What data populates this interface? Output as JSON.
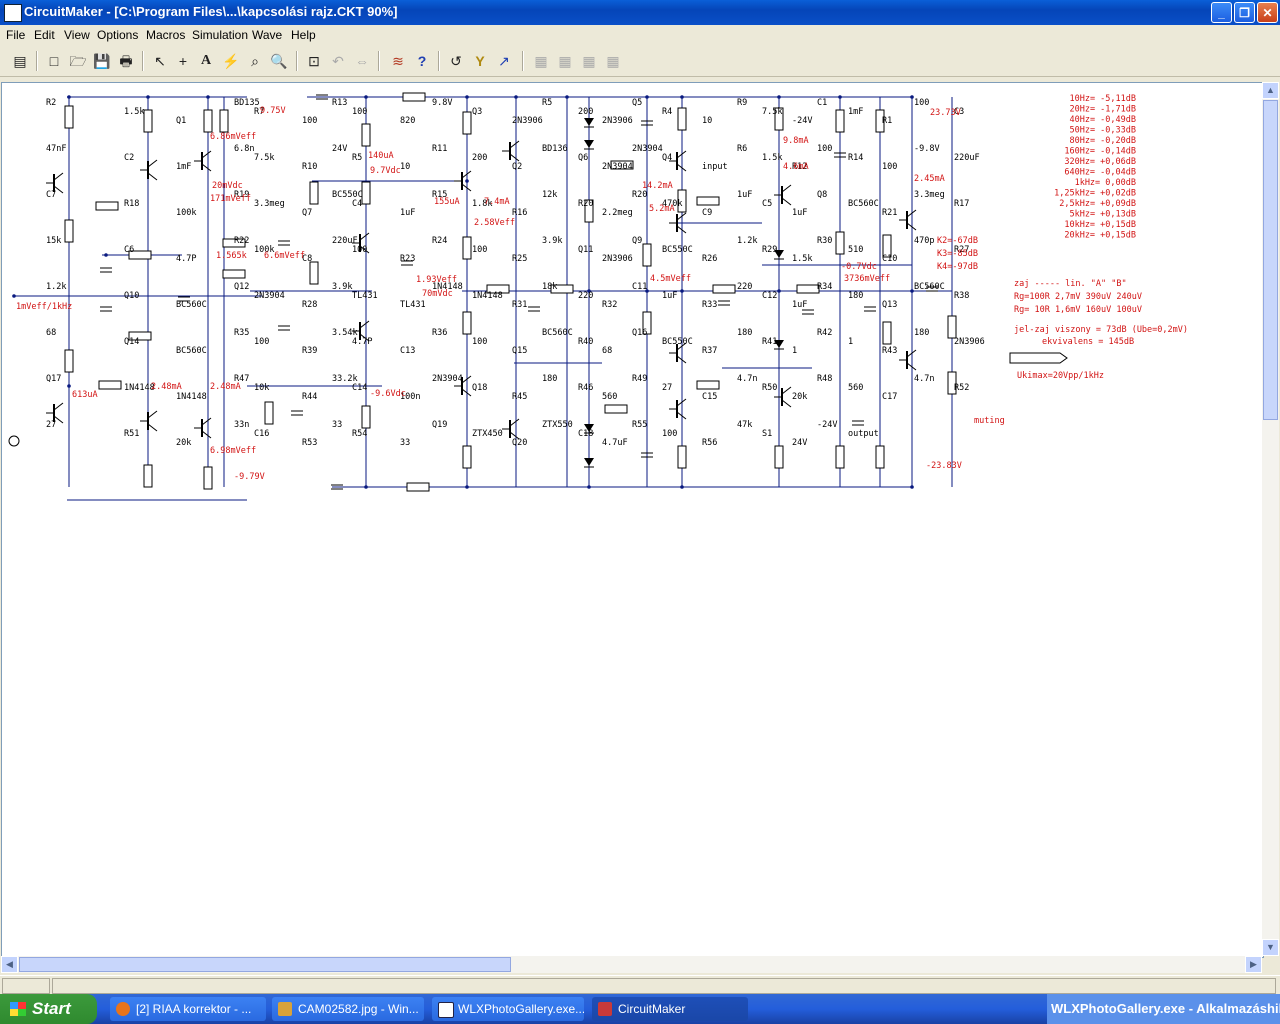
{
  "window": {
    "title": "CircuitMaker - [C:\\Program Files\\...\\kapcsolási rajz.CKT 90%]",
    "minimize": "_",
    "maximize": "❐",
    "close": "✕"
  },
  "menu": [
    "File",
    "Edit",
    "View",
    "Options",
    "Macros",
    "Simulation",
    "Wave",
    "Help"
  ],
  "toolbar_icons": [
    "binary-icon",
    "new-file-icon",
    "open-folder-icon",
    "save-icon",
    "print-icon",
    "arrow-pointer-icon",
    "wire-cross-icon",
    "text-tool-icon",
    "probe-icon",
    "wand-icon",
    "zoom-icon",
    "zoom-to-fit-icon",
    "rotate-icon",
    "mirror-icon",
    "digital-sim-icon",
    "help-icon",
    "reset-icon",
    "step-icon",
    "run-icon",
    "macro-icon"
  ],
  "toolbar_glyphs": [
    "▤",
    "□",
    "🗁",
    "💾",
    "🖶",
    "↖",
    "+",
    "A",
    "⚡",
    "⌕",
    "🔍",
    "⊡",
    "↶",
    "⇔",
    "≋",
    "?",
    "↺",
    "Y",
    "↗",
    "▦",
    "▦",
    "▦",
    "▦"
  ],
  "schematic": {
    "component_labels": [
      "R2",
      "1.5k",
      "Q1",
      "BD135",
      "R7",
      "100",
      "R13",
      "100",
      "820",
      "9.8V",
      "Q3",
      "2N3906",
      "R5",
      "200",
      "2N3906",
      "Q5",
      "R4",
      "10",
      "R9",
      "7.5k",
      "-24V",
      "C1",
      "1mF",
      "R1",
      "100",
      "C3",
      "47nF",
      "C2",
      "1mF",
      "6.8n",
      "7.5k",
      "R10",
      "24V",
      "R5",
      "10",
      "R11",
      "200",
      "Q2",
      "BD136",
      "Q6",
      "2N3904",
      "2N3904",
      "Q4",
      "input",
      "R6",
      "1.5k",
      "R12",
      "100",
      "R14",
      "100",
      "-9.8V",
      "220uF",
      "C7",
      "R18",
      "100k",
      "R19",
      "3.3meg",
      "Q7",
      "BC550C",
      "C4",
      "1uF",
      "R15",
      "1.8k",
      "R16",
      "12k",
      "R20",
      "2.2meg",
      "R20",
      "470k",
      "C9",
      "1uF",
      "C5",
      "1uF",
      "Q8",
      "BC560C",
      "R21",
      "3.3meg",
      "R17",
      "15k",
      "C6",
      "4.7P",
      "R22",
      "100k",
      "C8",
      "220uF",
      "100",
      "R23",
      "R24",
      "100",
      "R25",
      "3.9k",
      "Q11",
      "2N3906",
      "Q9",
      "BC550C",
      "R26",
      "1.2k",
      "R29",
      "1.5k",
      "R30",
      "510",
      "C10",
      "470p",
      "R27",
      "1.2k",
      "Q10",
      "BC560C",
      "Q12",
      "2N3904",
      "R28",
      "3.9k",
      "TL431",
      "TL431",
      "1N4148",
      "1N4148",
      "R31",
      "18k",
      "220",
      "R32",
      "C11",
      "1uF",
      "R33",
      "220",
      "C12",
      "1uF",
      "R34",
      "180",
      "Q13",
      "BC560C",
      "R38",
      "68",
      "Q14",
      "BC560C",
      "R35",
      "100",
      "R39",
      "3.54k",
      "4.7P",
      "C13",
      "R36",
      "100",
      "Q15",
      "BC560C",
      "R40",
      "68",
      "Q16",
      "BC550C",
      "R37",
      "180",
      "R41",
      "1",
      "R42",
      "1",
      "R43",
      "180",
      "2N3906",
      "Q17",
      "1N4148",
      "1N4148",
      "R47",
      "10k",
      "R44",
      "33.2k",
      "C14",
      "100n",
      "2N3904",
      "Q18",
      "R45",
      "180",
      "R46",
      "560",
      "R49",
      "27",
      "C15",
      "4.7n",
      "R50",
      "20k",
      "R48",
      "560",
      "C17",
      "4.7n",
      "R52",
      "27",
      "R51",
      "20k",
      "33n",
      "C16",
      "R53",
      "33",
      "R54",
      "33",
      "Q19",
      "ZTX450",
      "Q20",
      "ZTX550",
      "C18",
      "4.7uF",
      "R55",
      "100",
      "R56",
      "47k",
      "S1",
      "24V",
      "-24V",
      "output"
    ],
    "measurements": [
      "9.75V",
      "6.86mVeff",
      "20mVdc",
      "171mVeff",
      "1.565k",
      "6.6mVeff",
      "1mVeff/1kHz",
      "2.48mA",
      "613uA",
      "2.48mA",
      "6.98mVeff",
      "-9.79V",
      "140uA",
      "9.7Vdc",
      "155uA",
      "7.4mA",
      "2.58Veff",
      "1.93Veff",
      "70mVdc",
      "-9.6Vdc",
      "14.2mA",
      "5.2mA",
      "4.5mVeff",
      "9.8mA",
      "4.6mA",
      "-0.7Vdc",
      "3736mVeff",
      "2.45mA",
      "23.73V",
      "-23.83V",
      "muting"
    ],
    "annotations": {
      "freq_response": [
        "10Hz= -5,11dB",
        "20Hz= -1,71dB",
        "40Hz= -0,49dB",
        "50Hz= -0,33dB",
        "80Hz= -0,20dB",
        "160Hz= -0,14dB",
        "320Hz= +0,06dB",
        "640Hz= -0,04dB",
        "1kHz=  0,00dB",
        "1,25kHz= +0,02dB",
        "2,5kHz= +0,09dB",
        "5kHz= +0,13dB",
        "10kHz= +0,15dB",
        "20kHz= +0,15dB"
      ],
      "distortion": [
        "K2=-67dB",
        "K3=-85dB",
        "K4=-97dB"
      ],
      "noise_table": [
        "zaj ----- lin.   \"A\"    \"B\"",
        "Rg=100R  2,7mV  390uV  240uV",
        "Rg= 10R  1,6mV  160uV  100uV"
      ],
      "snr": "jel-zaj viszony = 73dB (Ube=0,2mV)",
      "equivalent": "ekvivalens = 145dB",
      "ukimax": "Ukimax=20Vpp/1kHz"
    }
  },
  "taskbar": {
    "start": "Start",
    "tasks": [
      {
        "label": "[2] RIAA korrektor - ...",
        "icon": "firefox-icon",
        "color": "#e8741b"
      },
      {
        "label": "CAM02582.jpg - Win...",
        "icon": "image-viewer-icon",
        "color": "#d8a23a"
      },
      {
        "label": "WLXPhotoGallery.exe...",
        "icon": "window-icon",
        "color": "#ffffff"
      },
      {
        "label": "CircuitMaker",
        "icon": "circuitmaker-icon",
        "color": "#c83a3a"
      }
    ],
    "tray": "WLXPhotoGallery.exe - Alkalmazáshiba"
  },
  "colors": {
    "wire": "#0a1a80",
    "component": "#000000",
    "measurement": "#d21414",
    "canvas": "#ffffff"
  }
}
